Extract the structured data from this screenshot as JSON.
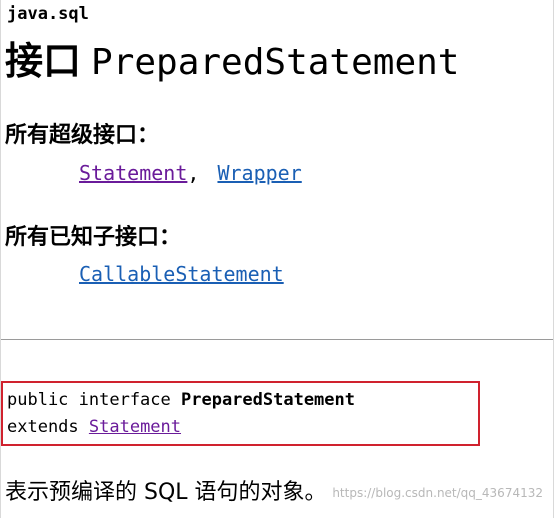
{
  "package_name": "java.sql",
  "title": {
    "keyword": "接口",
    "name": "PreparedStatement"
  },
  "superinterfaces": {
    "heading": "所有超级接口：",
    "items": [
      {
        "label": "Statement",
        "visited": true
      },
      {
        "label": "Wrapper",
        "visited": false
      }
    ],
    "separator": ","
  },
  "subinterfaces": {
    "heading": "所有已知子接口：",
    "items": [
      {
        "label": "CallableStatement",
        "visited": false
      }
    ]
  },
  "declaration": {
    "line1_prefix": "public interface ",
    "line1_name": "PreparedStatement",
    "line2_prefix": "extends ",
    "line2_link": "Statement"
  },
  "description": "表示预编译的 SQL 语句的对象。",
  "watermark": "https://blog.csdn.net/qq_43674132",
  "colors": {
    "visited_link": "#6a1b9a",
    "link": "#1a5fb4",
    "highlight_border": "#d0222e",
    "divider": "#9a9a9a"
  }
}
